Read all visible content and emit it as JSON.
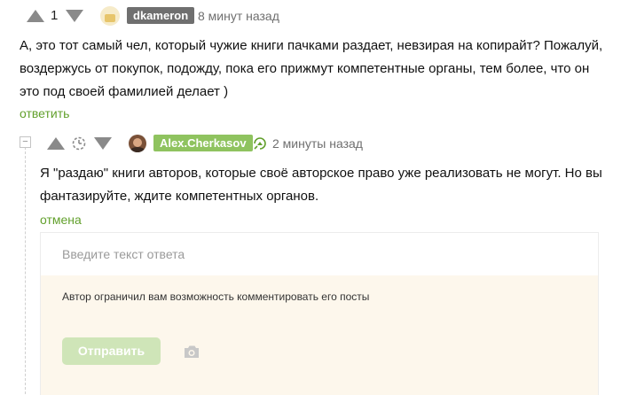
{
  "comment1": {
    "rating": "1",
    "username": "dkameron",
    "time": "8 минут назад",
    "text": "А, это тот самый чел, который чужие книги пачками раздает, невзирая на копирайт? Пожалуй, воздержусь от покупок, подожду, пока его прижмут компетентные органы, тем более, что он это под своей фамилией делает )",
    "reply_label": "ответить"
  },
  "comment2": {
    "username": "Alex.Cherkasov",
    "time": "2 минуты назад",
    "text": "Я \"раздаю\" книги авторов, которые своё авторское право уже реализовать не могут. Но вы фантазируйте, ждите компетентных органов.",
    "cancel_label": "отмена",
    "collapse_symbol": "−"
  },
  "reply_form": {
    "placeholder": "Введите текст ответа",
    "restriction_notice": "Автор ограничил вам возможность комментировать его посты",
    "submit_label": "Отправить"
  },
  "colors": {
    "accent": "#62a02c",
    "username_badge_1": "#6f6f6f",
    "username_badge_2": "#8fc35f",
    "notice_bg": "#fdf7ec"
  },
  "icons": [
    "upvote-icon",
    "downvote-icon",
    "timer-icon",
    "author-icon",
    "camera-icon"
  ]
}
